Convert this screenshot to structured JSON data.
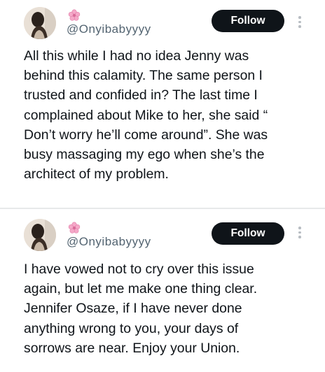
{
  "tweets": [
    {
      "handle": "@Onyibabyyyy",
      "follow_label": "Follow",
      "avatar_icon": "profile-photo",
      "badge_icon": "pink-flower-icon",
      "text": "All this while I had no idea Jenny was\nbehind this calamity. The same person I\ntrusted and confided in? The last time I\ncomplained about Mike to her, she said “\nDon’t worry he’ll come around”. She was\nbusy massaging my ego when she’s the\narchitect of my problem."
    },
    {
      "handle": "@Onyibabyyyy",
      "follow_label": "Follow",
      "avatar_icon": "profile-photo",
      "badge_icon": "pink-flower-icon",
      "text": "I have vowed not to cry over this issue\nagain, but let me make one thing clear.\nJennifer Osaze, if I have never done\nanything wrong to you, your days of\nsorrows are near. Enjoy your Union."
    }
  ],
  "colors": {
    "text": "#0f1419",
    "handle": "#536471",
    "follow_bg": "#0f1419",
    "follow_text": "#ffffff",
    "divider": "#e7e9ea",
    "flower": "#f5a8c8"
  }
}
